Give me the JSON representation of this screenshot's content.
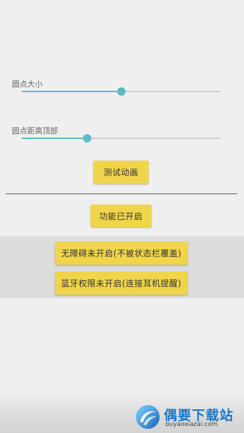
{
  "colors": {
    "accent": "#5bbcc4",
    "button": "#f0d54a",
    "track": "#cdcdcd"
  },
  "dot_size": {
    "label": "圆点大小",
    "value_fraction": 0.5
  },
  "dot_top_distance": {
    "label": "圆点距离顶部",
    "value_fraction": 0.33
  },
  "buttons": {
    "test_animation": "测试动画",
    "feature_enabled": "功能已开启",
    "accessibility_off": "无障碍未开启(不被状态栏覆盖)",
    "bluetooth_off": "蓝牙权限未开启(连接耳机提醒)"
  },
  "watermark": {
    "title": "偶要下载站",
    "url": "ouyaoxiazai.com",
    "logo_icon": "swirl-logo-icon"
  }
}
